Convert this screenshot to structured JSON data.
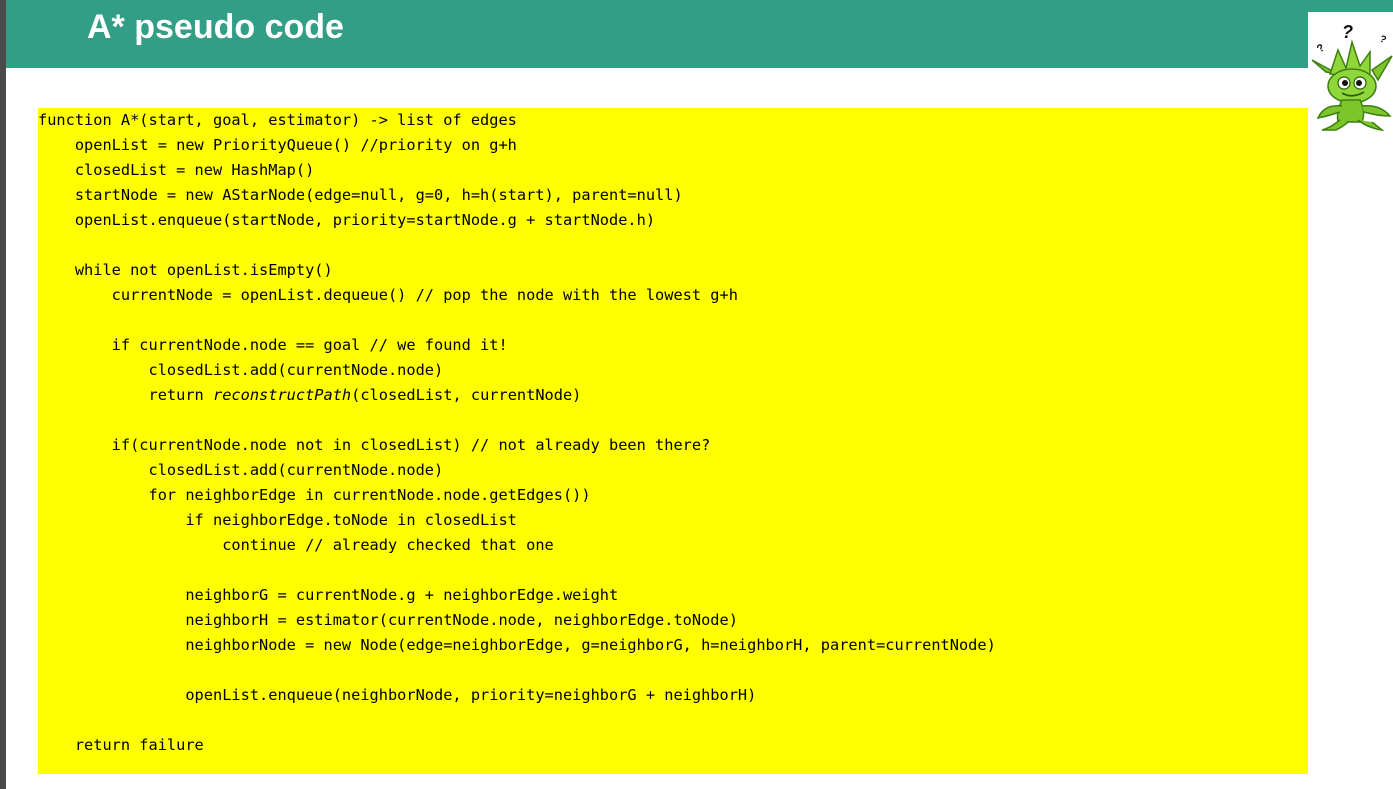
{
  "slide": {
    "title": "A* pseudo code"
  },
  "code": {
    "lines": [
      "function A*(start, goal, estimator) -> list of edges",
      "    openList = new PriorityQueue() //priority on g+h",
      "    closedList = new HashMap()",
      "    startNode = new AStarNode(edge=null, g=0, h=h(start), parent=null)",
      "    openList.enqueue(startNode, priority=startNode.g + startNode.h)",
      "",
      "    while not openList.isEmpty()",
      "        currentNode = openList.dequeue() // pop the node with the lowest g+h",
      "",
      "        if currentNode.node == goal // we found it!",
      "            closedList.add(currentNode.node)",
      "            return reconstructPath(closedList, currentNode)",
      "",
      "        if(currentNode.node not in closedList) // not already been there?",
      "            closedList.add(currentNode.node)",
      "            for neighborEdge in currentNode.node.getEdges())",
      "                if neighborEdge.toNode in closedList",
      "                    continue // already checked that one",
      "",
      "                neighborG = currentNode.g + neighborEdge.weight",
      "                neighborH = estimator(currentNode.node, neighborEdge.toNode)",
      "                neighborNode = new Node(edge=neighborEdge, g=neighborG, h=neighborH, parent=currentNode)",
      "",
      "                openList.enqueue(neighborNode, priority=neighborG + neighborH)",
      "",
      "    return failure"
    ],
    "return_keyword": "            return ",
    "italic_function": "reconstructPath",
    "return_args": "(closedList, currentNode)"
  },
  "mascot": {
    "icon": "goblin-mascot-icon",
    "marks": "?"
  },
  "colors": {
    "header": "#339e86",
    "code_background": "#ffff00",
    "title_text": "#ffffff",
    "edge": "#4a4a4a"
  }
}
